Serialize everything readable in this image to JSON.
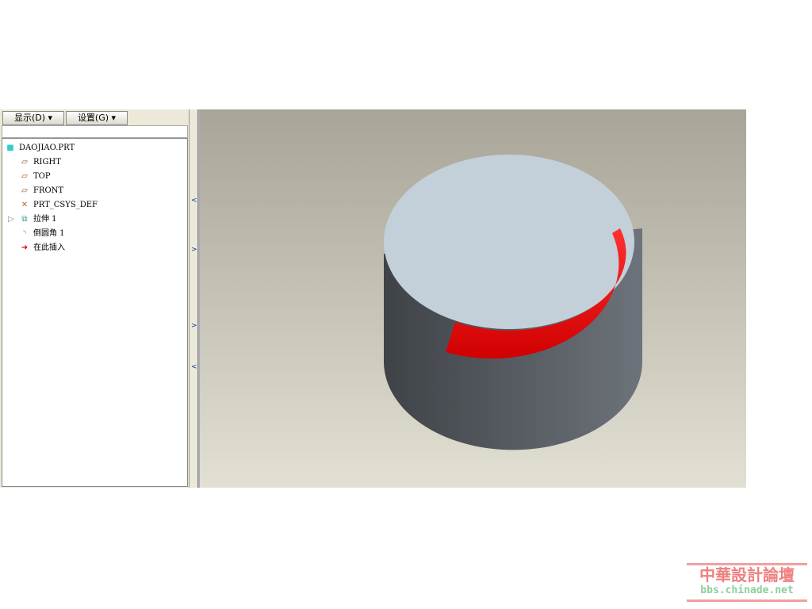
{
  "toolbar": {
    "show_label": "显示(D) ▾",
    "settings_label": "设置(G) ▾"
  },
  "tree": {
    "root": "DAOJIAO.PRT",
    "items": [
      {
        "label": "RIGHT",
        "icon": "datum-plane-icon"
      },
      {
        "label": "TOP",
        "icon": "datum-plane-icon"
      },
      {
        "label": "FRONT",
        "icon": "datum-plane-icon"
      },
      {
        "label": "PRT_CSYS_DEF",
        "icon": "csys-icon"
      },
      {
        "label": "拉伸 1",
        "icon": "extrude-icon"
      },
      {
        "label": "倒圆角 1",
        "icon": "round-icon"
      },
      {
        "label": "在此插入",
        "icon": "insert-arrow-icon"
      }
    ]
  },
  "watermark": {
    "title": "中華設計論壇",
    "url": "bbs.chinade.net"
  },
  "colors": {
    "fillet": "#ee0000",
    "top_face": "#c3d0da",
    "side": "#555b62"
  }
}
